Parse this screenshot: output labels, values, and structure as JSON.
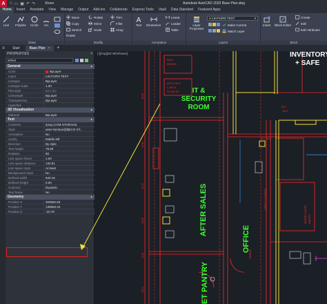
{
  "titlebar": {
    "logo": "A",
    "share": "Share",
    "title": "Autodesk AutoCAD 2026  Base Plan.dwg"
  },
  "ribbon_tabs": [
    "Home",
    "Insert",
    "Annotate",
    "View",
    "Manage",
    "Output",
    "Add-ins",
    "Collaborate",
    "Express Tools",
    "Vault",
    "Data Standard",
    "Featured Apps"
  ],
  "ribbon": {
    "draw": {
      "label": "Draw",
      "line": "Line",
      "polyline": "Polyline",
      "circle": "Circle",
      "arc": "Arc"
    },
    "modify": {
      "label": "Modify",
      "move": "Move",
      "copy": "Copy",
      "stretch": "Stretch",
      "rotate": "Rotate",
      "mirror": "Mirror",
      "scale": "Scale",
      "trim": "Trim",
      "fillet": "Fillet",
      "array": "Array"
    },
    "annotation": {
      "label": "Annotation",
      "text": "Text",
      "dimension": "Dimension",
      "linear": "Linear",
      "leader": "Leader",
      "table": "Table"
    },
    "layers": {
      "label": "Layers",
      "layer_properties": "Layer Properties",
      "layer_name": "LSI-FURN TEXT",
      "make_current": "Make Current",
      "match_layer": "Match Layer"
    },
    "block": {
      "label": "Block",
      "insert": "Insert",
      "block_editor": "Block Editor",
      "create": "Create",
      "edit": "Edit",
      "edit_attributes": "Edit Attributes"
    }
  },
  "filetabs": {
    "start": "Start",
    "base_plan": "Base Plan",
    "close": "×",
    "add": "+"
  },
  "properties": {
    "header": "PROPERTIES",
    "selection": "MText",
    "general_title": "General",
    "general": [
      {
        "k": "Color",
        "v": "ByLayer"
      },
      {
        "k": "Layer",
        "v": "LSI-FURN TEXT"
      },
      {
        "k": "Linetype",
        "v": "ByLayer"
      },
      {
        "k": "Linetype scale",
        "v": "1.00"
      },
      {
        "k": "Plot style",
        "v": "ByColor"
      },
      {
        "k": "Lineweight",
        "v": "ByLayer"
      },
      {
        "k": "Transparency",
        "v": "ByLayer"
      },
      {
        "k": "Hyperlink",
        "v": ""
      }
    ],
    "viz_title": "3D Visualization",
    "viz": [
      {
        "k": "Material",
        "v": "ByLayer"
      }
    ],
    "text_title": "Text",
    "text": [
      {
        "k": "Contents",
        "v": "\\pxqc;COM STORAGE"
      },
      {
        "k": "Style",
        "v": "anet~furnituri@$ECO-ST..."
      },
      {
        "k": "Annotative",
        "v": "No"
      },
      {
        "k": "Justify",
        "v": "Middle left"
      },
      {
        "k": "Direction",
        "v": "By style"
      },
      {
        "k": "Text height",
        "v": "79.69"
      },
      {
        "k": "Rotation",
        "v": "90"
      },
      {
        "k": "Line space factor",
        "v": "1.00"
      },
      {
        "k": "Line space distance",
        "v": "132.81"
      },
      {
        "k": "Line space style",
        "v": "At least"
      },
      {
        "k": "Background mask",
        "v": "No"
      },
      {
        "k": "Defined width",
        "v": "840.16"
      },
      {
        "k": "Defined height",
        "v": "0.00"
      },
      {
        "k": "Columns",
        "v": "Dynamic"
      },
      {
        "k": "Text frame",
        "v": "No"
      }
    ],
    "geo_title": "Geometry",
    "geometry": [
      {
        "k": "Position X",
        "v": "300692.83"
      },
      {
        "k": "Position Y",
        "v": "139563.34"
      },
      {
        "k": "Position Z",
        "v": "-10.78"
      }
    ]
  },
  "viewport": {
    "label": "[-][Top][2D Wireframe]",
    "rooms": {
      "it_security": "IT &\nSECURITY\nROOM",
      "after_sales": "AFTER SALES",
      "office": "OFFICE",
      "et_pantry": "ET PANTRY"
    },
    "top_right": "INVENTORY\n+ SAFE",
    "red_labels": [
      "RACK",
      "800X600",
      "ACTV RACK",
      "C-RACK",
      "FLOOR SP",
      "KEY",
      "BOX",
      "KEY BOX",
      "SAFETY LOCKERS",
      "WATER CLOSET",
      "PANTRY",
      "REFRIG",
      "SINK"
    ],
    "dims": [
      "1200",
      "1245",
      "1212",
      "1225",
      "1211",
      "1210"
    ]
  }
}
